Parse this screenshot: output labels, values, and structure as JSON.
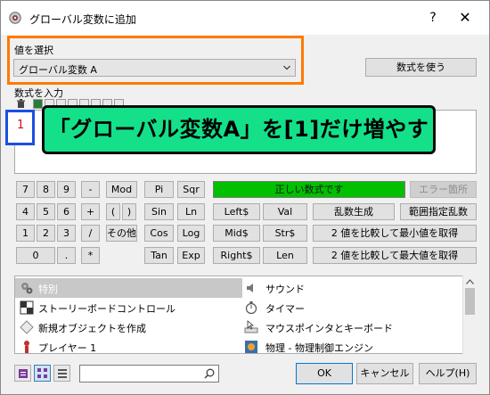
{
  "window": {
    "title": "グローバル変数に追加",
    "help_symbol": "?",
    "close_symbol": "✕"
  },
  "value_select": {
    "label": "値を選択",
    "selected": "グローバル変数 A"
  },
  "formula_button": "数式を使う",
  "formula_label": "数式を入力",
  "editor_value": "1",
  "banner_text": "「グローバル変数A」を[1]だけ増やす",
  "keypad": {
    "row1": [
      "7",
      "8",
      "9",
      "-",
      "Mod",
      "Pi",
      "Sqr"
    ],
    "row2": [
      "4",
      "5",
      "6",
      "+",
      "(",
      ")",
      "Sin",
      "Ln",
      "Left$",
      "Val",
      "乱数生成",
      "範囲指定乱数"
    ],
    "row3": [
      "1",
      "2",
      "3",
      "/",
      "その他",
      "Cos",
      "Log",
      "Mid$",
      "Str$",
      "2 値を比較して最小値を取得"
    ],
    "row4": [
      "0",
      ".",
      "*",
      "Tan",
      "Exp",
      "Right$",
      "Len",
      "2 値を比較して最大値を取得"
    ]
  },
  "status_text": "正しい数式です",
  "error_button": "エラー箇所",
  "list_items": [
    {
      "label": "特別",
      "icon": "gears-icon",
      "selected": true
    },
    {
      "label": "サウンド",
      "icon": "speaker-icon",
      "selected": false
    },
    {
      "label": "ストーリーボードコントロール",
      "icon": "checker-icon",
      "selected": false
    },
    {
      "label": "タイマー",
      "icon": "stopwatch-icon",
      "selected": false
    },
    {
      "label": "新規オブジェクトを作成",
      "icon": "diamond-icon",
      "selected": false
    },
    {
      "label": "マウスポインタとキーボード",
      "icon": "mouse-keyboard-icon",
      "selected": false
    },
    {
      "label": "プレイヤー 1",
      "icon": "player-icon",
      "selected": false
    },
    {
      "label": "物理 - 物理制御エンジン",
      "icon": "physics-icon",
      "selected": false
    }
  ],
  "search": {
    "value": ""
  },
  "buttons": {
    "ok": "OK",
    "cancel": "キャンセル",
    "help": "ヘルプ(H)"
  },
  "colors": {
    "highlight_orange": "#ff7a00",
    "highlight_blue": "#1b4fe0",
    "banner_green": "#14e08a",
    "status_green": "#00c000"
  }
}
